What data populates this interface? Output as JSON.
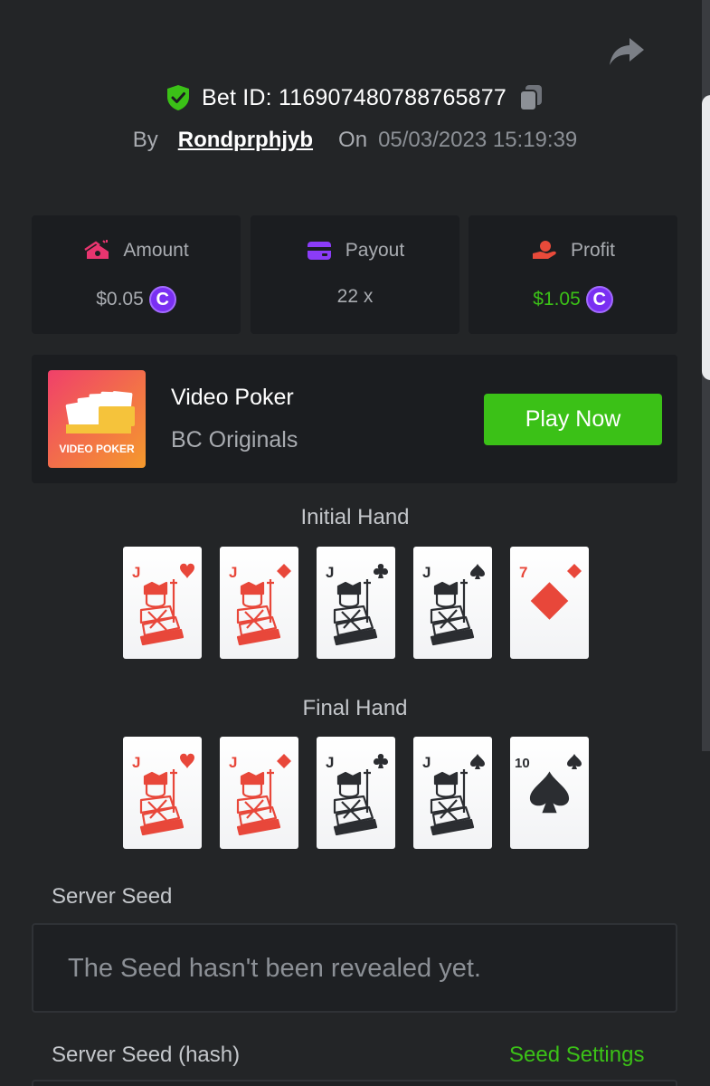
{
  "header": {
    "bet_id_label": "Bet ID: 116907480788765877",
    "by_label": "By",
    "username": "Rondprphjyb",
    "on_label": "On",
    "datetime": "05/03/2023 15:19:39"
  },
  "stats": {
    "amount": {
      "label": "Amount",
      "value": "$0.05",
      "coin": "C"
    },
    "payout": {
      "label": "Payout",
      "value": "22 x"
    },
    "profit": {
      "label": "Profit",
      "value": "$1.05",
      "coin": "C"
    }
  },
  "game": {
    "name": "Video Poker",
    "provider": "BC Originals",
    "thumb_text": "VIDEO POKER",
    "thumb_badge": "VIDEO POKER",
    "play_label": "Play Now"
  },
  "initial_hand": {
    "title": "Initial Hand",
    "cards": [
      {
        "rank": "J",
        "suit": "heart",
        "color": "red"
      },
      {
        "rank": "J",
        "suit": "diamond",
        "color": "red"
      },
      {
        "rank": "J",
        "suit": "club",
        "color": "black"
      },
      {
        "rank": "J",
        "suit": "spade",
        "color": "black"
      },
      {
        "rank": "7",
        "suit": "diamond",
        "color": "red"
      }
    ]
  },
  "final_hand": {
    "title": "Final Hand",
    "cards": [
      {
        "rank": "J",
        "suit": "heart",
        "color": "red"
      },
      {
        "rank": "J",
        "suit": "diamond",
        "color": "red"
      },
      {
        "rank": "J",
        "suit": "club",
        "color": "black"
      },
      {
        "rank": "J",
        "suit": "spade",
        "color": "black"
      },
      {
        "rank": "10",
        "suit": "spade",
        "color": "black"
      }
    ]
  },
  "server_seed": {
    "label": "Server Seed",
    "value": "The Seed hasn't been revealed yet."
  },
  "server_seed_hash": {
    "label": "Server Seed (hash)",
    "settings_label": "Seed Settings"
  },
  "colors": {
    "background": "#232527",
    "panel": "#1b1d20",
    "accent_green": "#3bc117",
    "coin_purple": "#7a2ff2",
    "card_red": "#e8473a",
    "card_black": "#2b2d31"
  },
  "icons": {
    "share": "share-arrow-icon",
    "verified": "shield-check-icon",
    "copy": "copy-icon",
    "amount": "money-stack-icon",
    "payout": "wallet-card-icon",
    "profit": "hand-coin-icon"
  }
}
